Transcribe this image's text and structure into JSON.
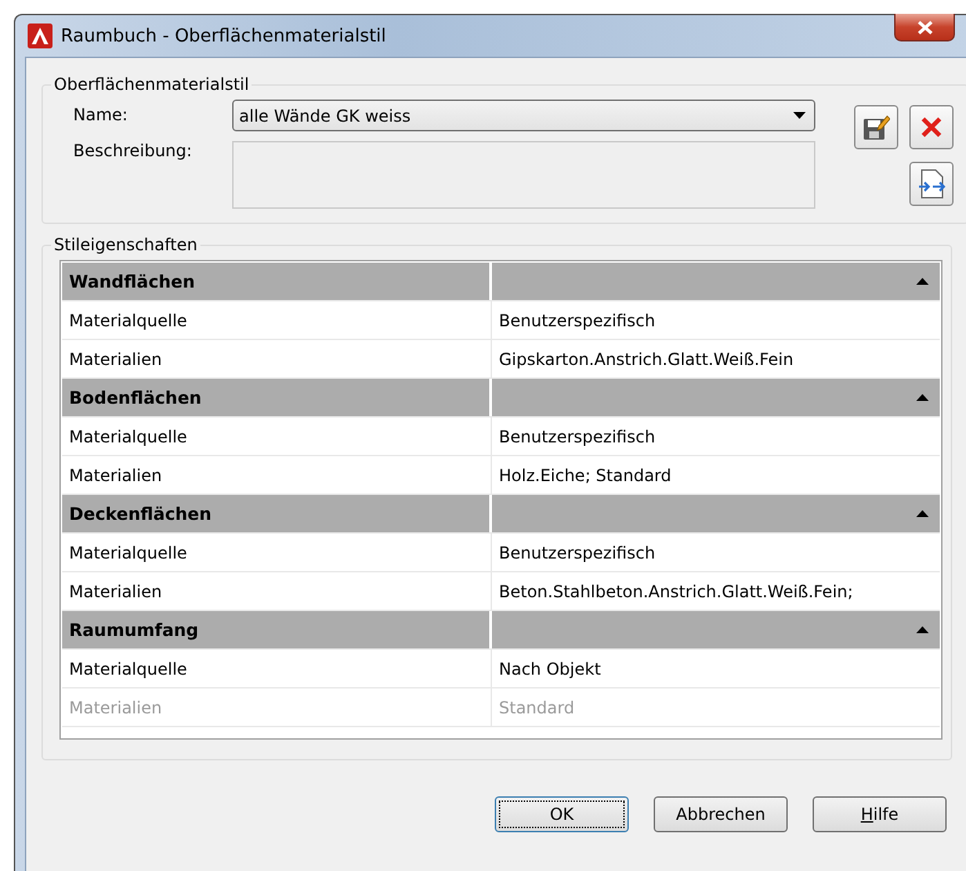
{
  "window": {
    "title": "Raumbuch - Oberflächenmaterialstil"
  },
  "style_group": {
    "title": "Oberflächenmaterialstil",
    "name_label": "Name:",
    "name_value": "alle Wände GK weiss",
    "description_label": "Beschreibung:"
  },
  "properties_group": {
    "title": "Stileigenschaften",
    "sections": [
      {
        "title": "Wandflächen",
        "expanded": true,
        "rows": [
          {
            "name": "Materialquelle",
            "value": "Benutzerspezifisch",
            "disabled": false
          },
          {
            "name": "Materialien",
            "value": "Gipskarton.Anstrich.Glatt.Weiß.Fein",
            "disabled": false
          }
        ]
      },
      {
        "title": "Bodenflächen",
        "expanded": true,
        "rows": [
          {
            "name": "Materialquelle",
            "value": "Benutzerspezifisch",
            "disabled": false
          },
          {
            "name": "Materialien",
            "value": "Holz.Eiche; Standard",
            "disabled": false
          }
        ]
      },
      {
        "title": "Deckenflächen",
        "expanded": true,
        "rows": [
          {
            "name": "Materialquelle",
            "value": "Benutzerspezifisch",
            "disabled": false
          },
          {
            "name": "Materialien",
            "value": "Beton.Stahlbeton.Anstrich.Glatt.Weiß.Fein;",
            "disabled": false
          }
        ]
      },
      {
        "title": "Raumumfang",
        "expanded": true,
        "rows": [
          {
            "name": "Materialquelle",
            "value": "Nach Objekt",
            "disabled": false
          },
          {
            "name": "Materialien",
            "value": "Standard",
            "disabled": true
          }
        ]
      }
    ]
  },
  "buttons": [
    {
      "label": "OK",
      "default": true,
      "mnemonic": false
    },
    {
      "label": "Abbrechen",
      "default": false,
      "mnemonic": false
    },
    {
      "label": "Hilfe",
      "default": false,
      "mnemonic": true
    }
  ]
}
